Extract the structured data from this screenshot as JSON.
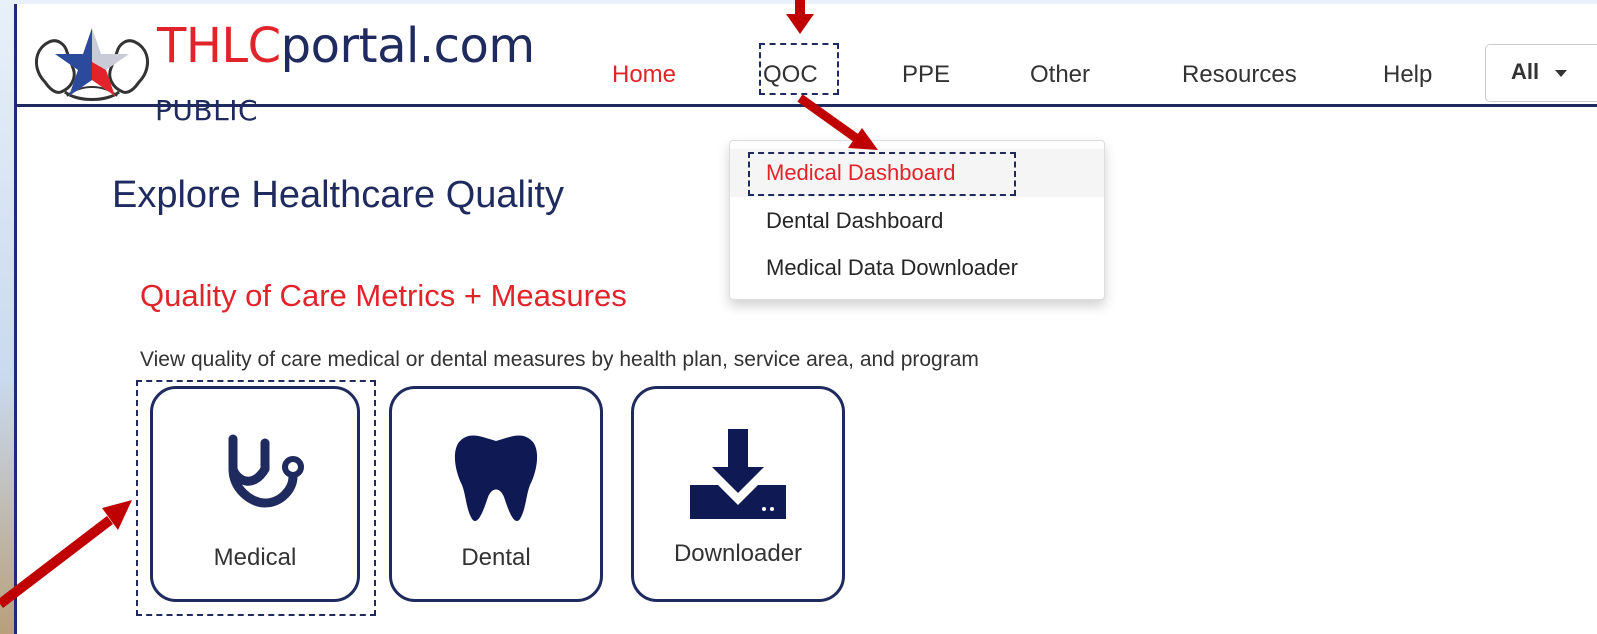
{
  "header": {
    "logo_main_red": "THLC",
    "logo_main_rest": "portal.com",
    "logo_sub": "PUBLIC",
    "nav": [
      {
        "label": "Home",
        "active": true
      },
      {
        "label": "QOC",
        "active": false
      },
      {
        "label": "PPE",
        "active": false
      },
      {
        "label": "Other",
        "active": false
      },
      {
        "label": "Resources",
        "active": false
      },
      {
        "label": "Help",
        "active": false
      }
    ],
    "select_value": "All"
  },
  "dropdown": {
    "items": [
      {
        "label": "Medical Dashboard",
        "active": true
      },
      {
        "label": "Dental Dashboard",
        "active": false
      },
      {
        "label": "Medical Data Downloader",
        "active": false
      }
    ]
  },
  "main": {
    "title": "Explore Healthcare Quality",
    "section_title": "Quality of Care Metrics + Measures",
    "section_desc": "View quality of care medical or dental measures by health plan, service area, and program",
    "cards": [
      {
        "label": "Medical",
        "icon": "stethoscope-icon"
      },
      {
        "label": "Dental",
        "icon": "tooth-icon"
      },
      {
        "label": "Downloader",
        "icon": "download-icon"
      }
    ]
  },
  "colors": {
    "brand_navy": "#1f2a5e",
    "brand_red": "#e2232a",
    "annotation_arrow": "#c00000"
  }
}
